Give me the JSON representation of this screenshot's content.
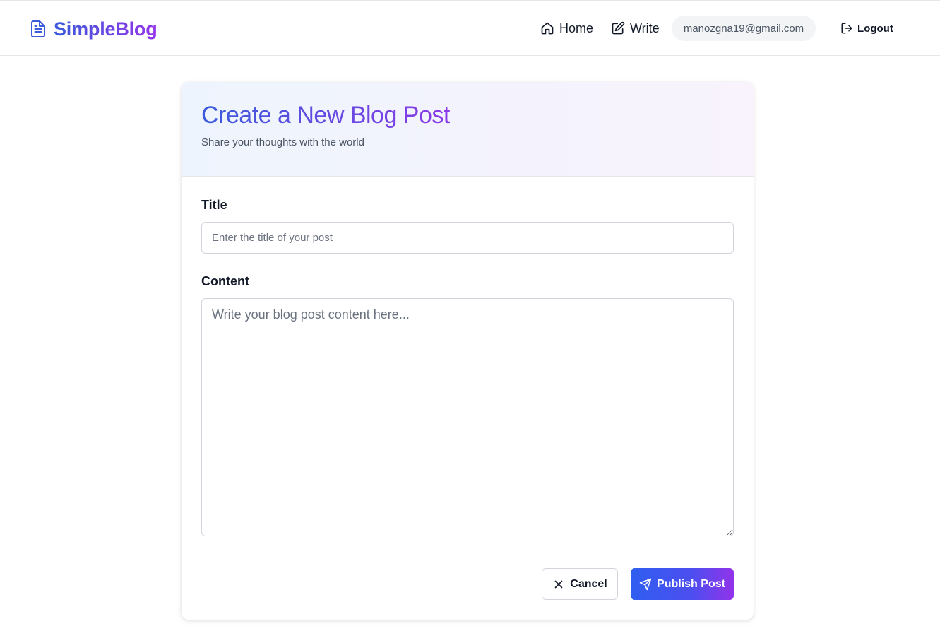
{
  "app": {
    "brand_name": "SimpleBlog",
    "brand_icon": "document-icon"
  },
  "nav": {
    "home_label": "Home",
    "home_icon": "home-icon",
    "write_label": "Write",
    "write_icon": "edit-icon",
    "user_email": "manozgna19@gmail.com",
    "logout_label": "Logout",
    "logout_icon": "logout-icon"
  },
  "form": {
    "heading": "Create a New Blog Post",
    "subheading": "Share your thoughts with the world",
    "title_label": "Title",
    "title_value": "",
    "title_placeholder": "Enter the title of your post",
    "content_label": "Content",
    "content_value": "",
    "content_placeholder": "Write your blog post content here...",
    "cancel_label": "Cancel",
    "cancel_icon": "close-icon",
    "publish_label": "Publish Post",
    "publish_icon": "send-icon"
  },
  "colors": {
    "accent_start": "#3b5bdb",
    "accent_end": "#9333ea",
    "publish_start": "#2f5ef0",
    "border": "#d1d5db"
  }
}
